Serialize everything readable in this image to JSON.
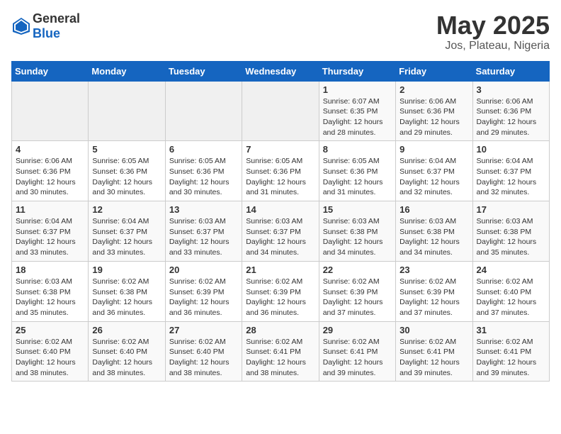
{
  "header": {
    "logo_general": "General",
    "logo_blue": "Blue",
    "title": "May 2025",
    "subtitle": "Jos, Plateau, Nigeria"
  },
  "weekdays": [
    "Sunday",
    "Monday",
    "Tuesday",
    "Wednesday",
    "Thursday",
    "Friday",
    "Saturday"
  ],
  "weeks": [
    [
      {
        "day": "",
        "info": ""
      },
      {
        "day": "",
        "info": ""
      },
      {
        "day": "",
        "info": ""
      },
      {
        "day": "",
        "info": ""
      },
      {
        "day": "1",
        "info": "Sunrise: 6:07 AM\nSunset: 6:35 PM\nDaylight: 12 hours\nand 28 minutes."
      },
      {
        "day": "2",
        "info": "Sunrise: 6:06 AM\nSunset: 6:36 PM\nDaylight: 12 hours\nand 29 minutes."
      },
      {
        "day": "3",
        "info": "Sunrise: 6:06 AM\nSunset: 6:36 PM\nDaylight: 12 hours\nand 29 minutes."
      }
    ],
    [
      {
        "day": "4",
        "info": "Sunrise: 6:06 AM\nSunset: 6:36 PM\nDaylight: 12 hours\nand 30 minutes."
      },
      {
        "day": "5",
        "info": "Sunrise: 6:05 AM\nSunset: 6:36 PM\nDaylight: 12 hours\nand 30 minutes."
      },
      {
        "day": "6",
        "info": "Sunrise: 6:05 AM\nSunset: 6:36 PM\nDaylight: 12 hours\nand 30 minutes."
      },
      {
        "day": "7",
        "info": "Sunrise: 6:05 AM\nSunset: 6:36 PM\nDaylight: 12 hours\nand 31 minutes."
      },
      {
        "day": "8",
        "info": "Sunrise: 6:05 AM\nSunset: 6:36 PM\nDaylight: 12 hours\nand 31 minutes."
      },
      {
        "day": "9",
        "info": "Sunrise: 6:04 AM\nSunset: 6:37 PM\nDaylight: 12 hours\nand 32 minutes."
      },
      {
        "day": "10",
        "info": "Sunrise: 6:04 AM\nSunset: 6:37 PM\nDaylight: 12 hours\nand 32 minutes."
      }
    ],
    [
      {
        "day": "11",
        "info": "Sunrise: 6:04 AM\nSunset: 6:37 PM\nDaylight: 12 hours\nand 33 minutes."
      },
      {
        "day": "12",
        "info": "Sunrise: 6:04 AM\nSunset: 6:37 PM\nDaylight: 12 hours\nand 33 minutes."
      },
      {
        "day": "13",
        "info": "Sunrise: 6:03 AM\nSunset: 6:37 PM\nDaylight: 12 hours\nand 33 minutes."
      },
      {
        "day": "14",
        "info": "Sunrise: 6:03 AM\nSunset: 6:37 PM\nDaylight: 12 hours\nand 34 minutes."
      },
      {
        "day": "15",
        "info": "Sunrise: 6:03 AM\nSunset: 6:38 PM\nDaylight: 12 hours\nand 34 minutes."
      },
      {
        "day": "16",
        "info": "Sunrise: 6:03 AM\nSunset: 6:38 PM\nDaylight: 12 hours\nand 34 minutes."
      },
      {
        "day": "17",
        "info": "Sunrise: 6:03 AM\nSunset: 6:38 PM\nDaylight: 12 hours\nand 35 minutes."
      }
    ],
    [
      {
        "day": "18",
        "info": "Sunrise: 6:03 AM\nSunset: 6:38 PM\nDaylight: 12 hours\nand 35 minutes."
      },
      {
        "day": "19",
        "info": "Sunrise: 6:02 AM\nSunset: 6:38 PM\nDaylight: 12 hours\nand 36 minutes."
      },
      {
        "day": "20",
        "info": "Sunrise: 6:02 AM\nSunset: 6:39 PM\nDaylight: 12 hours\nand 36 minutes."
      },
      {
        "day": "21",
        "info": "Sunrise: 6:02 AM\nSunset: 6:39 PM\nDaylight: 12 hours\nand 36 minutes."
      },
      {
        "day": "22",
        "info": "Sunrise: 6:02 AM\nSunset: 6:39 PM\nDaylight: 12 hours\nand 37 minutes."
      },
      {
        "day": "23",
        "info": "Sunrise: 6:02 AM\nSunset: 6:39 PM\nDaylight: 12 hours\nand 37 minutes."
      },
      {
        "day": "24",
        "info": "Sunrise: 6:02 AM\nSunset: 6:40 PM\nDaylight: 12 hours\nand 37 minutes."
      }
    ],
    [
      {
        "day": "25",
        "info": "Sunrise: 6:02 AM\nSunset: 6:40 PM\nDaylight: 12 hours\nand 38 minutes."
      },
      {
        "day": "26",
        "info": "Sunrise: 6:02 AM\nSunset: 6:40 PM\nDaylight: 12 hours\nand 38 minutes."
      },
      {
        "day": "27",
        "info": "Sunrise: 6:02 AM\nSunset: 6:40 PM\nDaylight: 12 hours\nand 38 minutes."
      },
      {
        "day": "28",
        "info": "Sunrise: 6:02 AM\nSunset: 6:41 PM\nDaylight: 12 hours\nand 38 minutes."
      },
      {
        "day": "29",
        "info": "Sunrise: 6:02 AM\nSunset: 6:41 PM\nDaylight: 12 hours\nand 39 minutes."
      },
      {
        "day": "30",
        "info": "Sunrise: 6:02 AM\nSunset: 6:41 PM\nDaylight: 12 hours\nand 39 minutes."
      },
      {
        "day": "31",
        "info": "Sunrise: 6:02 AM\nSunset: 6:41 PM\nDaylight: 12 hours\nand 39 minutes."
      }
    ]
  ]
}
